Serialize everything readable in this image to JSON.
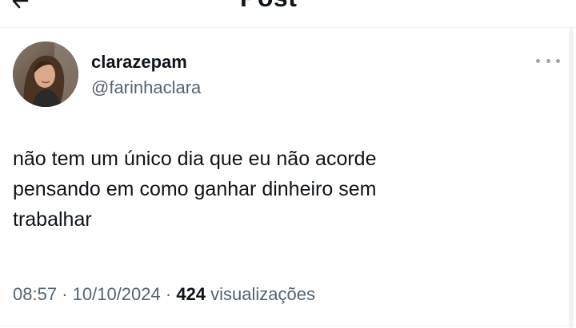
{
  "header": {
    "title": "Post",
    "back_icon": "arrow-left-icon"
  },
  "post": {
    "author": {
      "display_name": "clarazepam",
      "handle": "@farinhaclara",
      "avatar_icon": "avatar-photo"
    },
    "more_icon": "more-horizontal-icon",
    "text": "não tem um único dia que eu não acorde\npensando em como ganhar dinheiro sem\ntrabalhar",
    "time": "08:57",
    "separator": "·",
    "date": "10/10/2024",
    "views_count": "424",
    "views_label": "visualizações"
  },
  "colors": {
    "text_primary": "#0f1419",
    "text_secondary": "#536471",
    "background": "#ffffff"
  }
}
